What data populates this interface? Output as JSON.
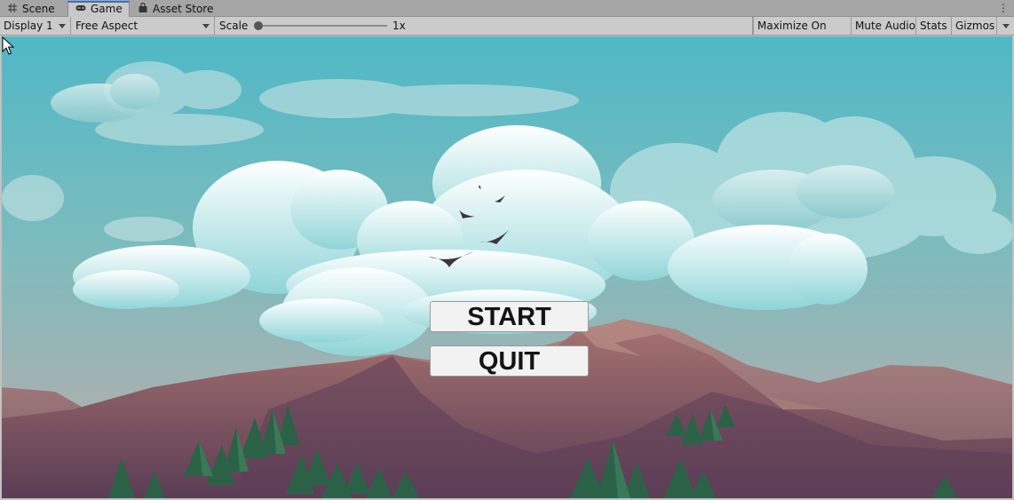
{
  "tabs": [
    {
      "label": "Scene",
      "icon": "grid-icon"
    },
    {
      "label": "Game",
      "icon": "gamepad-icon",
      "active": true
    },
    {
      "label": "Asset Store",
      "icon": "bag-icon"
    }
  ],
  "toolbar": {
    "display": "Display 1",
    "aspect": "Free Aspect",
    "scale_label": "Scale",
    "scale_value": "1x",
    "scale_level": 0.0,
    "maximize": "Maximize On Play",
    "mute": "Mute Audio",
    "stats": "Stats",
    "gizmos": "Gizmos"
  },
  "game": {
    "start_label": "START",
    "quit_label": "QUIT"
  },
  "colors": {
    "accent": "#3a72c4",
    "sky_top": "#52b9c6",
    "sky_bottom": "#aab0b0",
    "mountain": "#8c5e66",
    "tree": "#2f6a4a"
  }
}
